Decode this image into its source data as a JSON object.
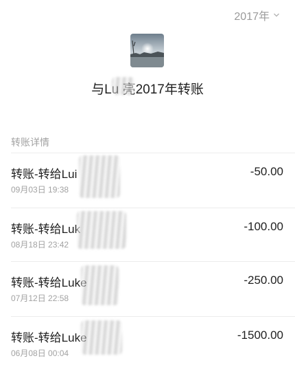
{
  "header": {
    "year_selector": "2017年",
    "title": "与Lu      亮2017年转账"
  },
  "section": {
    "label": "转账详情"
  },
  "transactions": [
    {
      "desc": "转账-转给Lui",
      "time": "09月03日 19:38",
      "amount": "-50.00"
    },
    {
      "desc": "转账-转给Luk",
      "time": "08月18日 23:42",
      "amount": "-100.00"
    },
    {
      "desc": "转账-转给Luke",
      "time": "07月12日 22:58",
      "amount": "-250.00"
    },
    {
      "desc": "转账-转给Luke",
      "time": "06月08日 00:04",
      "amount": "-1500.00"
    }
  ],
  "icons": {
    "year_dropdown": "chevron-down-icon",
    "avatar": "landscape-avatar"
  },
  "colors": {
    "primary_text": "#1f1f1f",
    "secondary_text": "#a2a2a2",
    "divider": "#ececec"
  }
}
